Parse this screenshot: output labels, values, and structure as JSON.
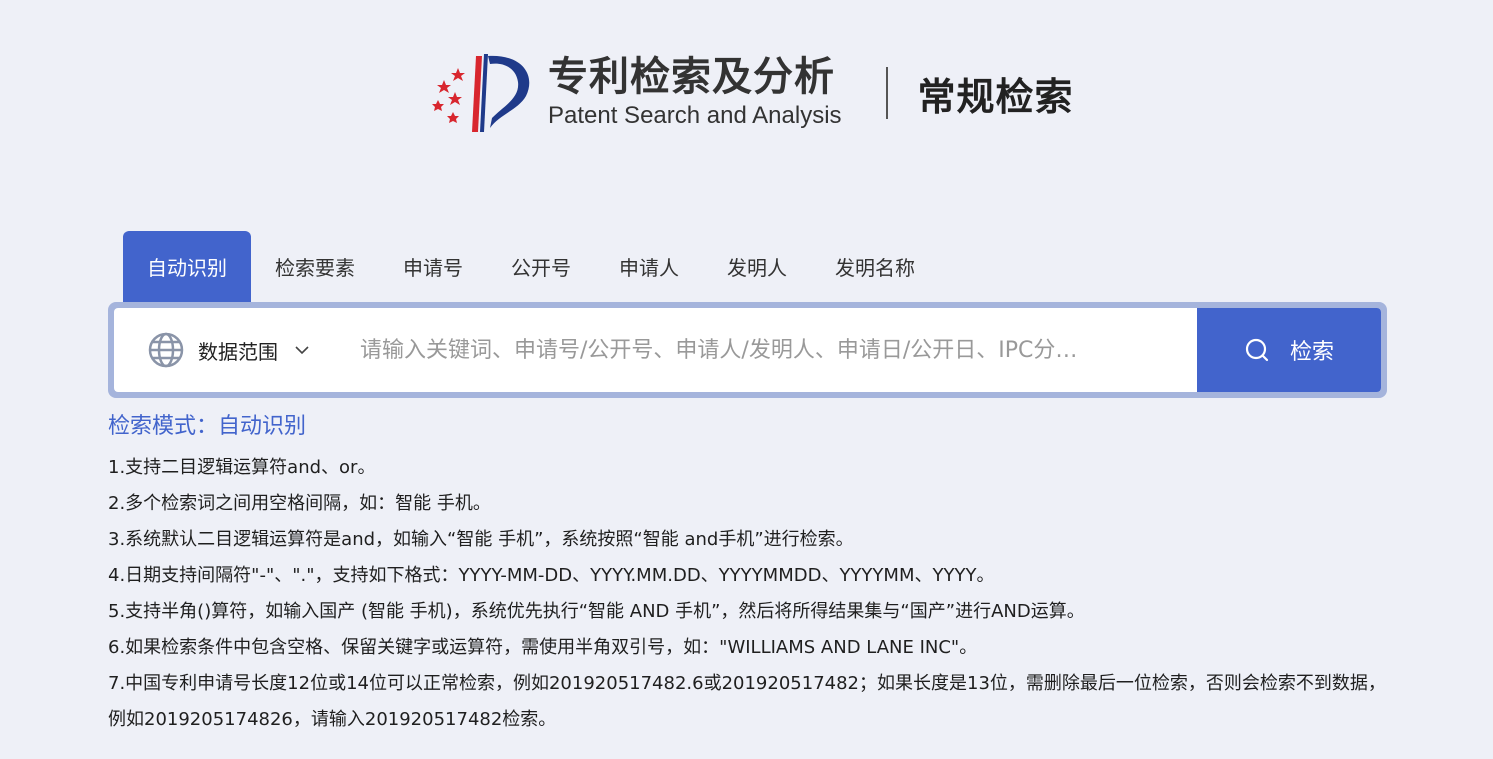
{
  "header": {
    "brand_cn": "专利检索及分析",
    "brand_en": "Patent Search and Analysis",
    "page_title": "常规检索"
  },
  "tabs": [
    {
      "label": "自动识别",
      "active": true
    },
    {
      "label": "检索要素",
      "active": false
    },
    {
      "label": "申请号",
      "active": false
    },
    {
      "label": "公开号",
      "active": false
    },
    {
      "label": "申请人",
      "active": false
    },
    {
      "label": "发明人",
      "active": false
    },
    {
      "label": "发明名称",
      "active": false
    }
  ],
  "search": {
    "scope_label": "数据范围",
    "placeholder": "请输入关键词、申请号/公开号、申请人/发明人、申请日/公开日、IPC分…",
    "value": "",
    "button_label": "检索"
  },
  "help": {
    "mode_text": "检索模式：自动识别",
    "items": [
      "1.支持二目逻辑运算符and、or。",
      "2.多个检索词之间用空格间隔，如：智能 手机。",
      "3.系统默认二目逻辑运算符是and，如输入“智能 手机”，系统按照“智能 and手机”进行检索。",
      "4.日期支持间隔符\"-\"、\".\"，支持如下格式：YYYY-MM-DD、YYYY.MM.DD、YYYYMMDD、YYYYMM、YYYY。",
      "5.支持半角()算符，如输入国产 (智能 手机)，系统优先执行“智能 AND 手机”，然后将所得结果集与“国产”进行AND运算。",
      "6.如果检索条件中包含空格、保留关键字或运算符，需使用半角双引号，如：\"WILLIAMS AND LANE INC\"。",
      "7.中国专利申请号长度12位或14位可以正常检索，例如201920517482.6或201920517482；如果长度是13位，需删除最后一位检索，否则会检索不到数据，例如2019205174826，请输入201920517482检索。"
    ]
  },
  "colors": {
    "accent": "#4264cc",
    "background": "#eef0f7",
    "search_border": "#a5b4dc",
    "logo_red": "#d8262e",
    "logo_blue": "#1f3a8a"
  },
  "icons": {
    "logo": "patent-logo",
    "scope": "globe-icon",
    "dropdown": "chevron-down-icon",
    "search": "search-icon"
  }
}
